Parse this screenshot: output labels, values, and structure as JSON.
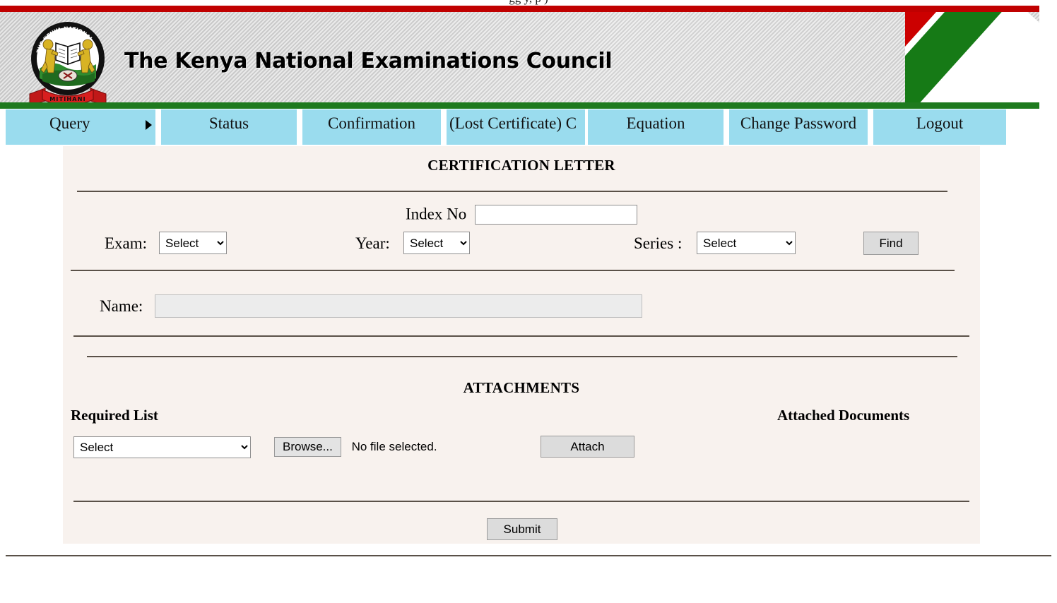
{
  "browser": {
    "clipped_top_text": "gg                            y, p          )"
  },
  "banner": {
    "title": "The Kenya National Examinations Council",
    "logo_name": "knec-crest-logo",
    "logo_motto": "MITIHANI",
    "logo_ring_top": "THE KENYA NATIONAL",
    "logo_ring_bottom": "EXAMINATIONS COUNCIL",
    "colors": {
      "top_stripe": "#c40000",
      "bottom_stripe": "#1e7a1e",
      "flag_black": "#000000",
      "flag_white": "#ffffff",
      "flag_red": "#cc0000",
      "flag_green": "#167a16",
      "banner_bg": "#d2d2d2"
    }
  },
  "nav": {
    "bg_color": "#9adcee",
    "items": [
      {
        "label": "Query",
        "has_submenu": true
      },
      {
        "label": "Status",
        "has_submenu": false
      },
      {
        "label": "Confirmation",
        "has_submenu": false
      },
      {
        "label": "(Lost Certificate) C",
        "has_submenu": false
      },
      {
        "label": "Equation",
        "has_submenu": false
      },
      {
        "label": "Change Password",
        "has_submenu": false
      },
      {
        "label": "Logout",
        "has_submenu": false
      }
    ]
  },
  "page": {
    "title": "CERTIFICATION LETTER",
    "panel_bg": "#f8f2ee"
  },
  "query": {
    "index_label": "Index No",
    "index_value": "",
    "index_placeholder": "",
    "exam_label": "Exam:",
    "exam_value": "Select",
    "exam_options": [
      "Select"
    ],
    "year_label": "Year:",
    "year_value": "Select",
    "year_options": [
      "Select"
    ],
    "series_label": "Series :",
    "series_value": "Select",
    "series_options": [
      "Select"
    ],
    "find_label": "Find"
  },
  "candidate": {
    "name_label": "Name:",
    "name_value": "",
    "name_placeholder": ""
  },
  "attachments": {
    "heading": "ATTACHMENTS",
    "required_list_header": "Required List",
    "attached_documents_header": "Attached Documents",
    "required_value": "Select",
    "required_options": [
      "Select"
    ],
    "browse_label": "Browse...",
    "file_status": "No file selected.",
    "attach_label": "Attach",
    "attached_items": []
  },
  "footer": {
    "submit_label": "Submit"
  }
}
